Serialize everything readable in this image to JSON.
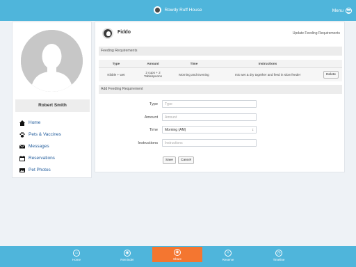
{
  "header": {
    "title": "Rowdy Ruff House",
    "menu_label": "Menu"
  },
  "sidebar": {
    "user_name": "Robert Smith",
    "items": [
      {
        "label": "Home",
        "icon": "home-icon"
      },
      {
        "label": "Pets & Vaccines",
        "icon": "paw-icon"
      },
      {
        "label": "Messages",
        "icon": "envelope-icon"
      },
      {
        "label": "Reservations",
        "icon": "calendar-icon"
      },
      {
        "label": "Pet Photos",
        "icon": "photo-icon"
      }
    ]
  },
  "pet": {
    "name": "Fiddo",
    "update_link": "Update Feeding Requirements"
  },
  "feeding": {
    "section_title": "Feeding Requirements",
    "columns": [
      "Type",
      "Amount",
      "Time",
      "Instructions"
    ],
    "rows": [
      {
        "type": "Kibble + wet",
        "amount_line1": "2 cups + 2",
        "amount_line2": "Tablespoons",
        "time": "Morning and Evening",
        "instructions": "mix wet & dry together and feed in slow feeder",
        "action": "Delete"
      }
    ]
  },
  "add_form": {
    "section_title": "Add Feeding Requirement",
    "type_label": "Type",
    "type_placeholder": "Type",
    "amount_label": "Amount",
    "amount_placeholder": "Amount",
    "time_label": "Time",
    "time_value": "Morning (AM)",
    "instructions_label": "Instructions",
    "instructions_placeholder": "Instructions",
    "save_label": "Save",
    "cancel_label": "Cancel"
  },
  "bottom_nav": {
    "tabs": [
      {
        "label": "Home",
        "icon": "home-icon"
      },
      {
        "label": "Reminder",
        "icon": "reminder-icon"
      },
      {
        "label": "Share",
        "icon": "share-icon"
      },
      {
        "label": "Reserve",
        "icon": "plus-icon"
      },
      {
        "label": "Timeline",
        "icon": "clock-icon"
      }
    ],
    "active": "Share"
  },
  "colors": {
    "primary": "#4fb5db",
    "active_tab": "#f47630",
    "link": "#1f5a9a"
  }
}
